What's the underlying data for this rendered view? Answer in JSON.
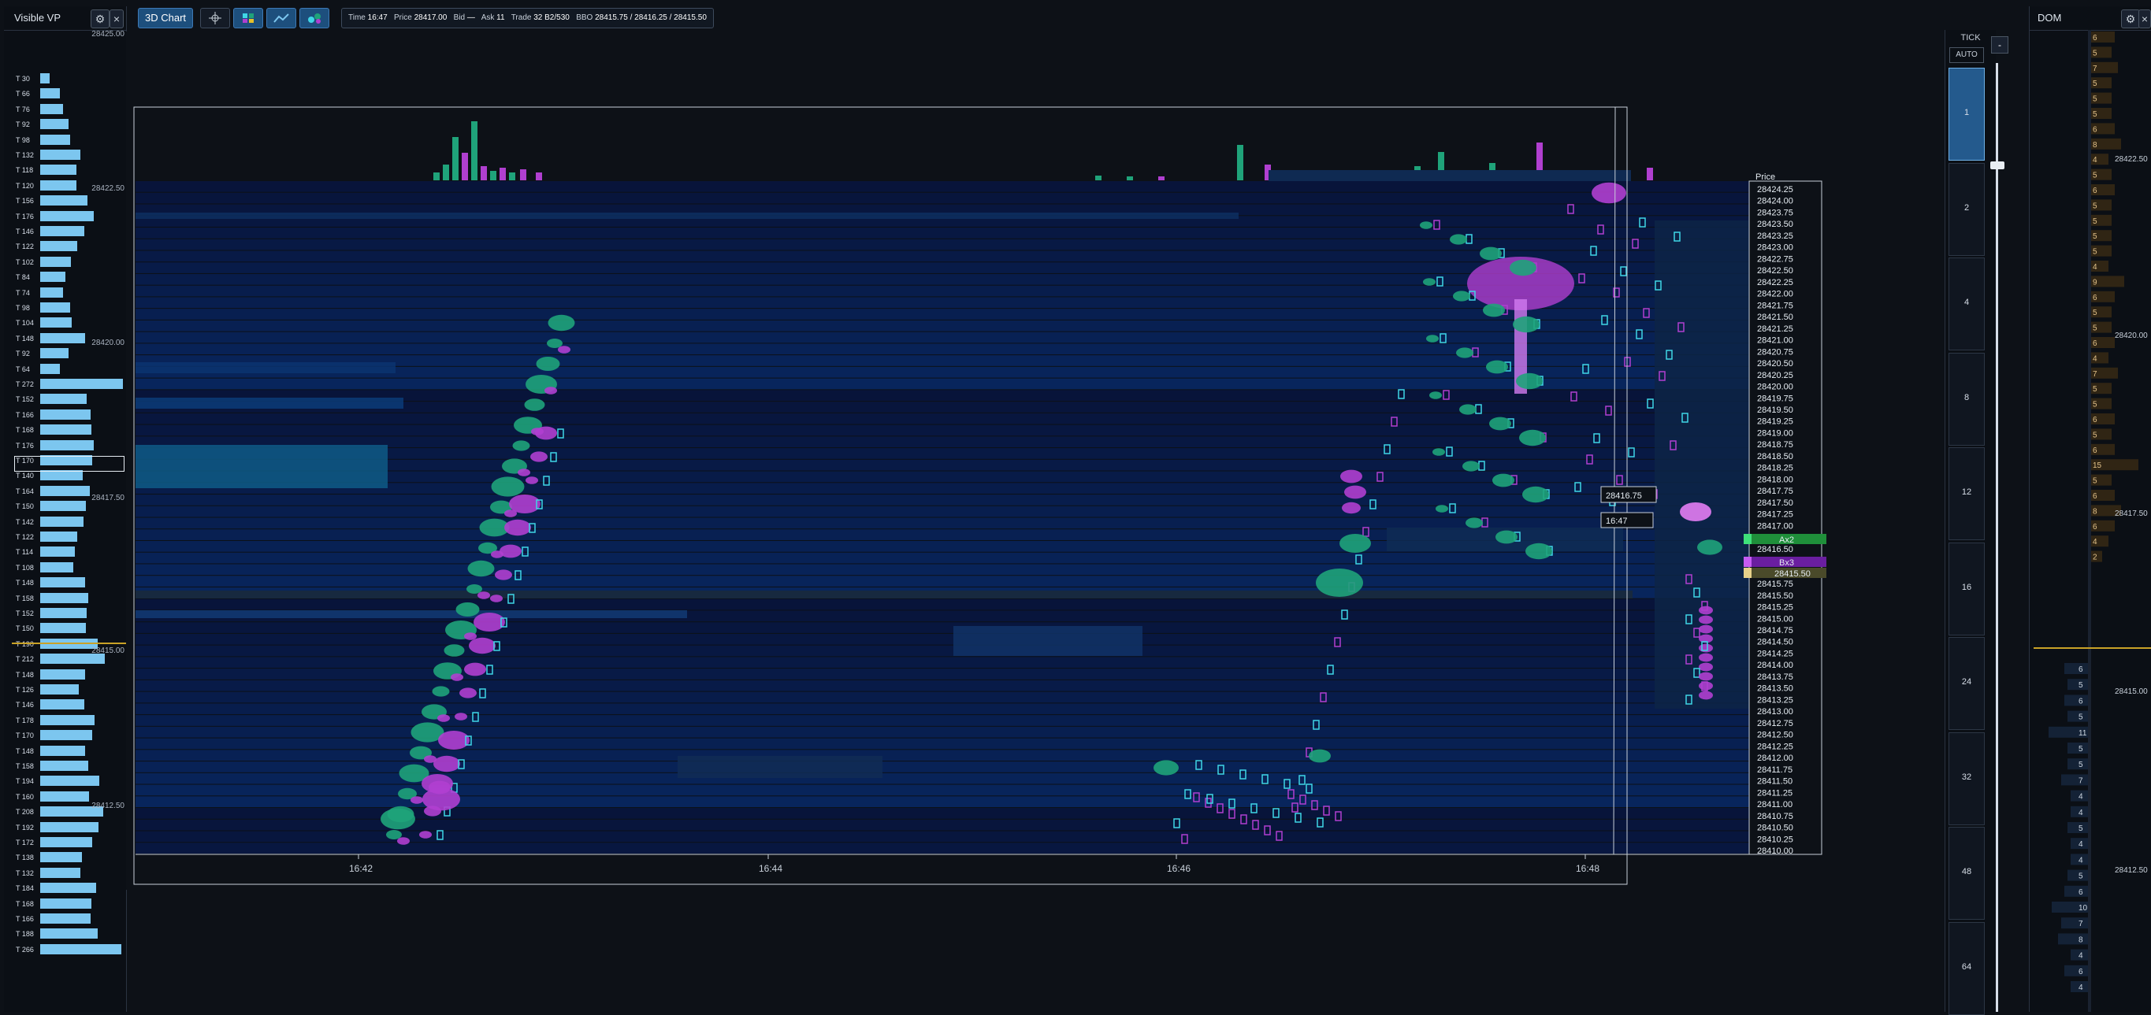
{
  "visible_vp": {
    "title": "Visible VP",
    "settings_icon": "gear-icon",
    "close_label": "×",
    "rows": [
      {
        "label": "T 30",
        "value": 30
      },
      {
        "label": "T 66",
        "value": 66
      },
      {
        "label": "T 76",
        "value": 76
      },
      {
        "label": "T 92",
        "value": 92
      },
      {
        "label": "T 98",
        "value": 98
      },
      {
        "label": "T 132",
        "value": 132
      },
      {
        "label": "T 118",
        "value": 118
      },
      {
        "label": "T 120",
        "value": 120
      },
      {
        "label": "T 156",
        "value": 156
      },
      {
        "label": "T 176",
        "value": 176
      },
      {
        "label": "T 146",
        "value": 146
      },
      {
        "label": "T 122",
        "value": 122
      },
      {
        "label": "T 102",
        "value": 102
      },
      {
        "label": "T 84",
        "value": 84
      },
      {
        "label": "T 74",
        "value": 74
      },
      {
        "label": "T 98",
        "value": 98
      },
      {
        "label": "T 104",
        "value": 104
      },
      {
        "label": "T 148",
        "value": 148
      },
      {
        "label": "T 92",
        "value": 92
      },
      {
        "label": "T 64",
        "value": 64
      },
      {
        "label": "T 272",
        "value": 272
      },
      {
        "label": "T 152",
        "value": 152
      },
      {
        "label": "T 166",
        "value": 166
      },
      {
        "label": "T 168",
        "value": 168
      },
      {
        "label": "T 176",
        "value": 176
      },
      {
        "label": "T 170",
        "value": 170
      },
      {
        "label": "T 140",
        "value": 140
      },
      {
        "label": "T 164",
        "value": 164
      },
      {
        "label": "T 150",
        "value": 150
      },
      {
        "label": "T 142",
        "value": 142
      },
      {
        "label": "T 122",
        "value": 122
      },
      {
        "label": "T 114",
        "value": 114
      },
      {
        "label": "T 108",
        "value": 108
      },
      {
        "label": "T 148",
        "value": 148
      },
      {
        "label": "T 158",
        "value": 158
      },
      {
        "label": "T 152",
        "value": 152
      },
      {
        "label": "T 150",
        "value": 150
      },
      {
        "label": "T 190",
        "value": 190
      },
      {
        "label": "T 212",
        "value": 212
      },
      {
        "label": "T 148",
        "value": 148
      },
      {
        "label": "T 126",
        "value": 126
      },
      {
        "label": "T 146",
        "value": 146
      },
      {
        "label": "T 178",
        "value": 178
      },
      {
        "label": "T 170",
        "value": 170
      },
      {
        "label": "T 148",
        "value": 148
      },
      {
        "label": "T 158",
        "value": 158
      },
      {
        "label": "T 194",
        "value": 194
      },
      {
        "label": "T 160",
        "value": 160
      },
      {
        "label": "T 208",
        "value": 208
      },
      {
        "label": "T 192",
        "value": 192
      },
      {
        "label": "T 172",
        "value": 172
      },
      {
        "label": "T 138",
        "value": 138
      },
      {
        "label": "T 132",
        "value": 132
      },
      {
        "label": "T 184",
        "value": 184
      },
      {
        "label": "T 168",
        "value": 168
      },
      {
        "label": "T 166",
        "value": 166
      },
      {
        "label": "T 188",
        "value": 188
      },
      {
        "label": "T 266",
        "value": 266
      }
    ],
    "price_labels": [
      "28425.00",
      "28422.50",
      "28420.00",
      "28417.50",
      "28415.00",
      "28412.50"
    ],
    "bar_color": "#7cc6ef"
  },
  "toolbar": {
    "chart_3d_label": "3D Chart",
    "buttons": [
      {
        "name": "crosshair-icon"
      },
      {
        "name": "heatmap-icon"
      },
      {
        "name": "line-chart-icon"
      },
      {
        "name": "bubbles-icon"
      }
    ],
    "info": {
      "time_key": "Time",
      "time_val": "16:47",
      "price_key": "Price",
      "price_val": "28417.00",
      "bid_key": "Bid",
      "bid_val": "—",
      "ask_key": "Ask",
      "ask_val": "11",
      "trade_key": "Trade",
      "trade_val": "32 B2/530",
      "bbo_key": "BBO",
      "bbo_val": "28415.75 / 28416.25 / 28415.50"
    }
  },
  "chart": {
    "price_axis_title": "Price",
    "price_ticks": [
      "28424.25",
      "28424.00",
      "28423.75",
      "28423.50",
      "28423.25",
      "28423.00",
      "28422.75",
      "28422.50",
      "28422.25",
      "28422.00",
      "28421.75",
      "28421.50",
      "28421.25",
      "28421.00",
      "28420.75",
      "28420.50",
      "28420.25",
      "28420.00",
      "28419.75",
      "28419.50",
      "28419.25",
      "28419.00",
      "28418.75",
      "28418.50",
      "28418.25",
      "28418.00",
      "28417.75",
      "28417.50",
      "28417.25",
      "28417.00",
      "28416.75",
      "28416.50",
      "28416.25",
      "28416.00",
      "28415.75",
      "28415.50",
      "28415.25",
      "28415.00",
      "28414.75",
      "28414.50",
      "28414.25",
      "28414.00",
      "28413.75",
      "28413.50",
      "28413.25",
      "28413.00",
      "28412.75",
      "28412.50",
      "28412.25",
      "28412.00",
      "28411.75",
      "28411.50",
      "28411.25",
      "28411.00",
      "28410.75",
      "28410.50",
      "28410.25",
      "28410.00"
    ],
    "time_ticks": [
      "16:42",
      "16:44",
      "16:46",
      "16:48"
    ],
    "ask_marker": "Ax2",
    "bid_marker": "Bx3",
    "last_price": "28415.50",
    "crosshair_price": "28416.75",
    "crosshair_time": "16:47",
    "colors": {
      "buy": "#1fa37a",
      "sell": "#b03fd0",
      "cyan": "#3fd6e6",
      "heat": "#143a6e",
      "grid": "#0e1d36",
      "ask": "#1f8f3a",
      "bid": "#6a1ea0",
      "last": "#c9b36a"
    }
  },
  "tick_panel": {
    "title": "TICK",
    "auto_label": "AUTO",
    "options": [
      "1",
      "2",
      "4",
      "8",
      "12",
      "16",
      "24",
      "32",
      "48",
      "64"
    ],
    "selected": "1",
    "zoom_minus": "-"
  },
  "dom": {
    "title": "DOM",
    "settings_icon": "gear-icon",
    "close_label": "×",
    "ask_sizes": [
      "6",
      "5",
      "7",
      "5",
      "5",
      "5",
      "6",
      "8",
      "4",
      "5",
      "6",
      "5",
      "5",
      "5",
      "5",
      "4",
      "9",
      "6",
      "5",
      "5",
      "6",
      "4",
      "7",
      "5",
      "5",
      "6",
      "5",
      "6",
      "15",
      "5",
      "6",
      "8",
      "6",
      "4",
      "2"
    ],
    "bid_sizes": [
      "6",
      "5",
      "6",
      "5",
      "11",
      "5",
      "5",
      "7",
      "4",
      "4",
      "5",
      "4",
      "4",
      "5",
      "6",
      "10",
      "7",
      "8",
      "4",
      "6",
      "4"
    ],
    "price_labels": [
      "28422.50",
      "28420.00",
      "28417.50",
      "28415.00",
      "28412.50"
    ]
  }
}
